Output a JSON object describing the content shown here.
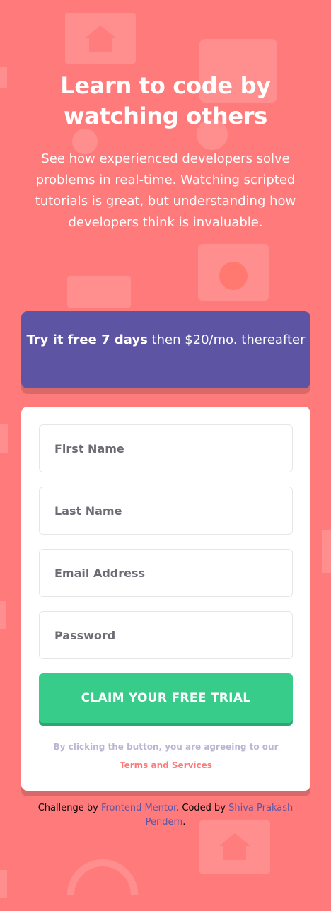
{
  "hero": {
    "title": "Learn to code by watching others",
    "text": "See how experienced developers solve problems in real-time. Watching scripted tutorials is great, but understanding how developers think is invaluable."
  },
  "promo": {
    "bold": "Try it free 7 days",
    "rest": " then $20/mo. thereafter"
  },
  "form": {
    "first_name_placeholder": "First Name",
    "last_name_placeholder": "Last Name",
    "email_placeholder": "Email Address",
    "password_placeholder": "Password",
    "submit_label": "CLAIM YOUR FREE TRIAL",
    "terms_prefix": "By clicking the button, you are agreeing to our",
    "terms_link": "Terms and Services"
  },
  "footer": {
    "prefix": "Challenge by ",
    "mentor_link": "Frontend Mentor",
    "middle": ". Coded by ",
    "author_link": "Shiva Prakash Pendem",
    "suffix": "."
  },
  "colors": {
    "background": "#ff7b7b",
    "promo": "#5e54a4",
    "button": "#38cc8b",
    "link": "#ff7979"
  }
}
